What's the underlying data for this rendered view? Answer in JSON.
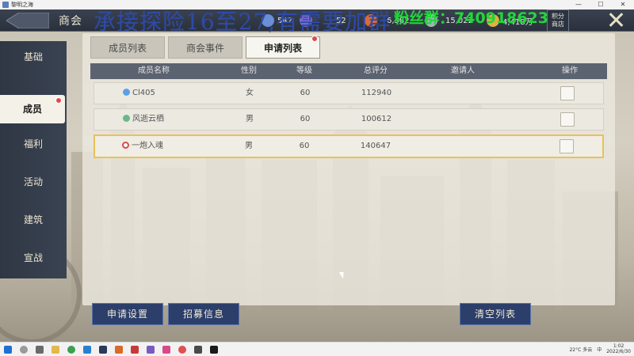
{
  "window": {
    "app_title": "黎明之海",
    "controls": [
      "—",
      "☐",
      "✕"
    ]
  },
  "topbar": {
    "title": "商会",
    "watermark": "承接探险16至27,有需要加群",
    "fans_group": "粉丝群：740918623",
    "resources": [
      {
        "value": "542",
        "icon": "crystal-icon",
        "color": "#6a8fd8"
      },
      {
        "value": "52",
        "icon": "ticket-icon",
        "color": "#7a6ad0"
      },
      {
        "value": "6,382",
        "icon": "gem-icon",
        "color": "#d86a3a"
      },
      {
        "value": "15,022",
        "icon": "silver-icon",
        "color": "#a8b0bc"
      },
      {
        "value": "4,418万",
        "icon": "gold-coin-icon",
        "color": "#e0b040"
      }
    ],
    "shop_label_1": "积分",
    "shop_label_2": "商店"
  },
  "sidebar": {
    "items": [
      {
        "label": "基础"
      },
      {
        "label": "成员"
      },
      {
        "label": "福利"
      },
      {
        "label": "活动"
      },
      {
        "label": "建筑"
      },
      {
        "label": "宣战"
      }
    ]
  },
  "tabs": [
    {
      "label": "成员列表"
    },
    {
      "label": "商会事件"
    },
    {
      "label": "申请列表"
    }
  ],
  "table": {
    "headers": [
      "成员名称",
      "性别",
      "等级",
      "总评分",
      "邀请人",
      "操作"
    ],
    "rows": [
      {
        "name": "Cl405",
        "gender": "女",
        "level": "60",
        "score": "112940",
        "inviter": "",
        "icon": "water-drop-icon",
        "icon_color": "#5aa0e8"
      },
      {
        "name": "风逝云栖",
        "gender": "男",
        "level": "60",
        "score": "100612",
        "inviter": "",
        "icon": "leaf-icon",
        "icon_color": "#6ab88a"
      },
      {
        "name": "一炮入魂",
        "gender": "男",
        "level": "60",
        "score": "140647",
        "inviter": "",
        "icon": "no-entry-icon",
        "icon_color": "#d84a4a"
      }
    ]
  },
  "buttons": {
    "apply_settings": "申请设置",
    "recruit_info": "招募信息",
    "clear_list": "清空列表"
  },
  "tray": {
    "weather": "22°C 多云",
    "time": "1:02",
    "date": "2022/6/30",
    "ime": "中"
  }
}
